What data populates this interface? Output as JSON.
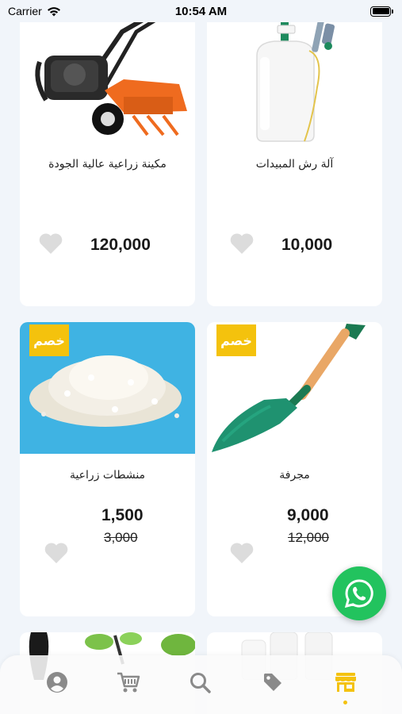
{
  "status_bar": {
    "carrier": "Carrier",
    "time": "10:54 AM"
  },
  "products": [
    {
      "title": "آلة رش المبيدات",
      "price": "10,000",
      "old_price": "",
      "badge": "",
      "image": "pesticide-sprayer-image"
    },
    {
      "title": "مكينة زراعية عالية الجودة",
      "price": "120,000",
      "old_price": "",
      "badge": "",
      "image": "tiller-machine-image"
    },
    {
      "title": "مجرفة",
      "price": "9,000",
      "old_price": "12,000",
      "badge": "خصم",
      "image": "shovel-image"
    },
    {
      "title": "منشطات زراعية",
      "price": "1,500",
      "old_price": "3,000",
      "badge": "خصم",
      "image": "fertilizer-granules-image"
    }
  ],
  "tabbar": {
    "items": [
      {
        "icon": "profile-icon",
        "active": false
      },
      {
        "icon": "cart-icon",
        "active": false
      },
      {
        "icon": "search-icon",
        "active": false
      },
      {
        "icon": "tag-icon",
        "active": false
      },
      {
        "icon": "store-icon",
        "active": true
      }
    ]
  },
  "colors": {
    "accent": "#f4c20d",
    "whatsapp": "#22c35e",
    "background": "#f1f5fa",
    "badge_text": "#ffffff"
  }
}
